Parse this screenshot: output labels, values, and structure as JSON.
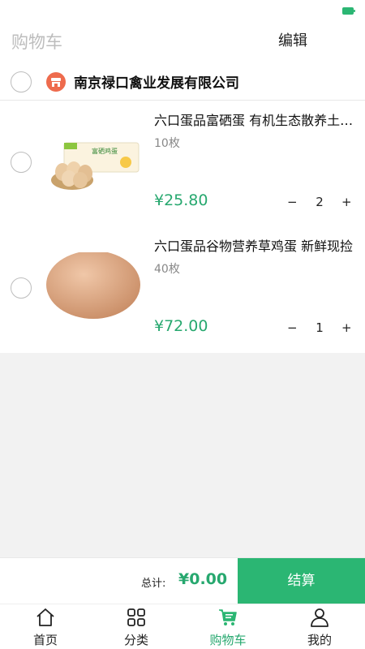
{
  "header": {
    "title": "购物车",
    "edit_label": "编辑"
  },
  "store": {
    "name": "南京禄口禽业发展有限公司",
    "icon": "store-icon"
  },
  "items": [
    {
      "title": "六口蛋品富硒蛋 有机生态散养土鸡蛋",
      "spec": "10枚",
      "price": "¥25.80",
      "quantity": "2",
      "image": "egg-box-image",
      "package_text": "富硒鸡蛋"
    },
    {
      "title": "六口蛋品谷物营养草鸡蛋 新鲜现捡",
      "spec": "40枚",
      "price": "¥72.00",
      "quantity": "1",
      "image": "brown-egg-image"
    }
  ],
  "stepper": {
    "minus": "−",
    "plus": "+"
  },
  "footer": {
    "total_label": "总计:",
    "total_value": "¥0.00",
    "checkout_label": "结算"
  },
  "tabs": [
    {
      "label": "首页",
      "icon": "home-icon"
    },
    {
      "label": "分类",
      "icon": "category-icon"
    },
    {
      "label": "购物车",
      "icon": "cart-icon",
      "active": true
    },
    {
      "label": "我的",
      "icon": "user-icon"
    }
  ],
  "colors": {
    "accent": "#2bb673",
    "price": "#27a86f",
    "store_icon": "#ee6b4d"
  }
}
